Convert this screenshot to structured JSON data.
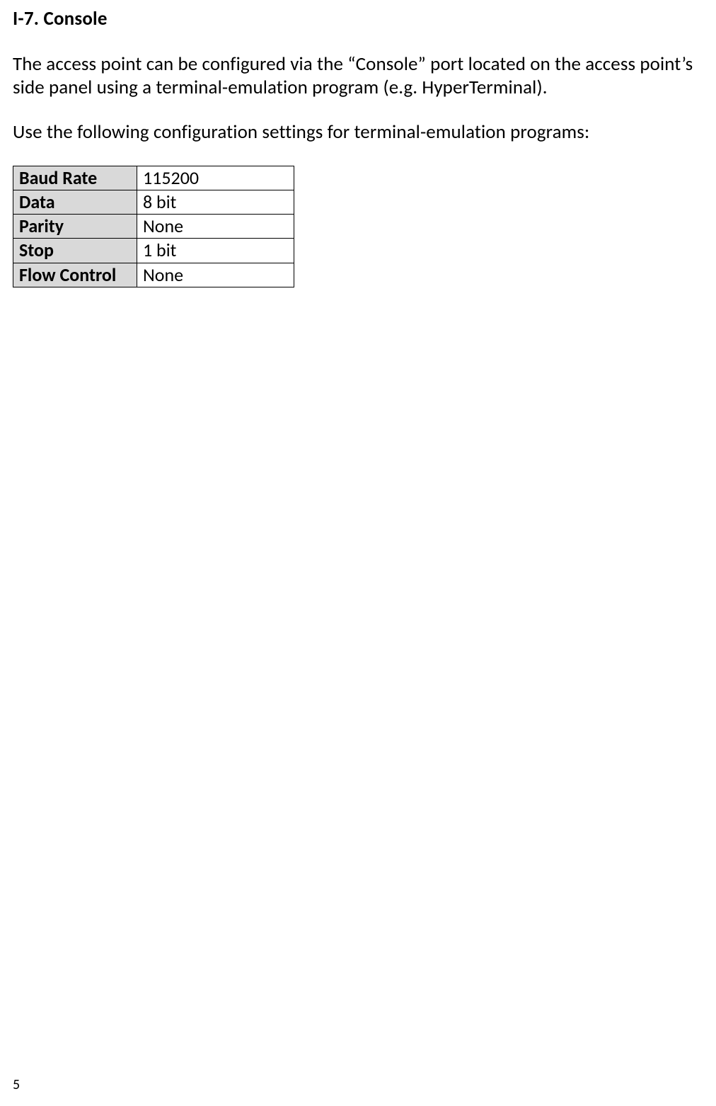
{
  "heading": "I-7. Console",
  "paragraph1": "The access point can be configured via the “Console” port located on the access point’s side panel using a terminal-emulation program (e.g. HyperTerminal).",
  "paragraph2": "Use the following configuration settings for terminal-emulation programs:",
  "table": {
    "rows": [
      {
        "label": "Baud Rate",
        "value": "115200"
      },
      {
        "label": "Data",
        "value": "8 bit"
      },
      {
        "label": "Parity",
        "value": "None"
      },
      {
        "label": "Stop",
        "value": "1 bit"
      },
      {
        "label": "Flow Control",
        "value": "None"
      }
    ]
  },
  "page_number": "5"
}
